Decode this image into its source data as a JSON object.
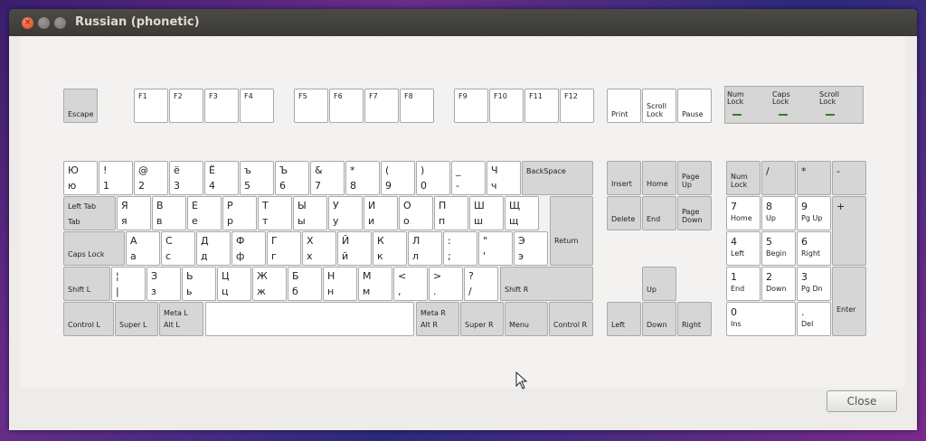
{
  "window": {
    "title": "Russian (phonetic)",
    "close_icon": "×"
  },
  "keys": {
    "esc": {
      "label": "Escape"
    },
    "f1": "F1",
    "f2": "F2",
    "f3": "F3",
    "f4": "F4",
    "f5": "F5",
    "f6": "F6",
    "f7": "F7",
    "f8": "F8",
    "f9": "F9",
    "f10": "F10",
    "f11": "F11",
    "f12": "F12",
    "print": "Print",
    "scroll": "Scroll\nLock",
    "pause": "Pause",
    "leds": {
      "num": "Num\nLock",
      "caps": "Caps\nLock",
      "scroll": "Scroll\nLock"
    },
    "row1": [
      {
        "t": "Ю",
        "b": "ю"
      },
      {
        "t": "!",
        "b": "1"
      },
      {
        "t": "@",
        "b": "2"
      },
      {
        "t": "ё",
        "b": "3"
      },
      {
        "t": "Ё",
        "b": "4"
      },
      {
        "t": "ъ",
        "b": "5"
      },
      {
        "t": "Ъ",
        "b": "6"
      },
      {
        "t": "&",
        "b": "7"
      },
      {
        "t": "*",
        "b": "8"
      },
      {
        "t": "(",
        "b": "9"
      },
      {
        "t": ")",
        "b": "0"
      },
      {
        "t": "_",
        "b": "-"
      },
      {
        "t": "Ч",
        "b": "ч"
      }
    ],
    "backspace": "BackSpace",
    "tab": {
      "top": "Left Tab",
      "bot": "Tab"
    },
    "row2": [
      {
        "t": "Я",
        "b": "я"
      },
      {
        "t": "В",
        "b": "в"
      },
      {
        "t": "Е",
        "b": "е"
      },
      {
        "t": "Р",
        "b": "р"
      },
      {
        "t": "Т",
        "b": "т"
      },
      {
        "t": "Ы",
        "b": "ы"
      },
      {
        "t": "У",
        "b": "у"
      },
      {
        "t": "И",
        "b": "и"
      },
      {
        "t": "О",
        "b": "о"
      },
      {
        "t": "П",
        "b": "п"
      },
      {
        "t": "Ш",
        "b": "ш"
      },
      {
        "t": "Щ",
        "b": "щ"
      }
    ],
    "return": "Return",
    "caps": "Caps Lock",
    "row3": [
      {
        "t": "А",
        "b": "а"
      },
      {
        "t": "С",
        "b": "с"
      },
      {
        "t": "Д",
        "b": "д"
      },
      {
        "t": "Ф",
        "b": "ф"
      },
      {
        "t": "Г",
        "b": "г"
      },
      {
        "t": "Х",
        "b": "х"
      },
      {
        "t": "Й",
        "b": "й"
      },
      {
        "t": "К",
        "b": "к"
      },
      {
        "t": "Л",
        "b": "л"
      },
      {
        "t": ":",
        "b": ";"
      },
      {
        "t": "\"",
        "b": "'"
      },
      {
        "t": "Э",
        "b": "э"
      }
    ],
    "shiftl": "Shift L",
    "row4": [
      {
        "t": "¦",
        "b": "|"
      },
      {
        "t": "З",
        "b": "з"
      },
      {
        "t": "Ь",
        "b": "ь"
      },
      {
        "t": "Ц",
        "b": "ц"
      },
      {
        "t": "Ж",
        "b": "ж"
      },
      {
        "t": "Б",
        "b": "б"
      },
      {
        "t": "Н",
        "b": "н"
      },
      {
        "t": "М",
        "b": "м"
      },
      {
        "t": "<",
        "b": ","
      },
      {
        "t": ">",
        "b": "."
      },
      {
        "t": "?",
        "b": "/"
      }
    ],
    "shiftr": "Shift R",
    "ctrll": "Control L",
    "superl": "Super L",
    "metal": "Meta L\nAlt L",
    "metar": "Meta R\nAlt R",
    "superr": "Super R",
    "menu": "Menu",
    "ctrlr": "Control R",
    "insert": "Insert",
    "home": "Home",
    "pgup": "Page\nUp",
    "delete": "Delete",
    "end": "End",
    "pgdn": "Page\nDown",
    "up": "Up",
    "left": "Left",
    "down": "Down",
    "right": "Right",
    "numlock": "Num\nLock",
    "kpdiv": "/",
    "kpmul": "*",
    "kpminus": "-",
    "kp7": {
      "n": "7",
      "s": "Home"
    },
    "kp8": {
      "n": "8",
      "s": "Up"
    },
    "kp9": {
      "n": "9",
      "s": "Pg Up"
    },
    "kpplus": "+",
    "kp4": {
      "n": "4",
      "s": "Left"
    },
    "kp5": {
      "n": "5",
      "s": "Begin"
    },
    "kp6": {
      "n": "6",
      "s": "Right"
    },
    "kp1": {
      "n": "1",
      "s": "End"
    },
    "kp2": {
      "n": "2",
      "s": "Down"
    },
    "kp3": {
      "n": "3",
      "s": "Pg Dn"
    },
    "kpenter": "Enter",
    "kp0": {
      "n": "0",
      "s": "Ins"
    },
    "kpdot": {
      "n": ".",
      "s": "Del"
    }
  },
  "close_button": "Close"
}
